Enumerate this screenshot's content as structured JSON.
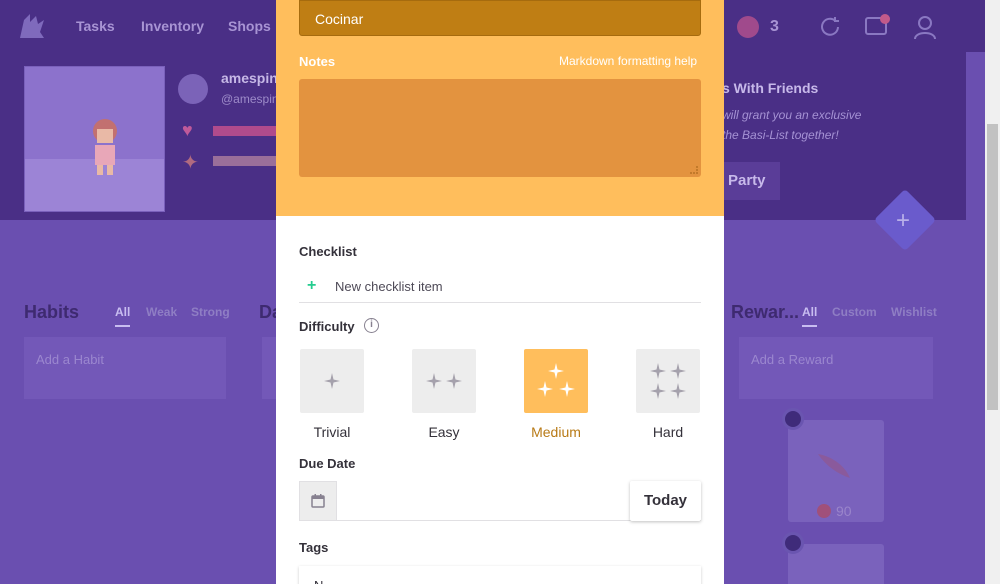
{
  "nav": {
    "items": [
      "Tasks",
      "Inventory",
      "Shops"
    ],
    "gems_count": "3"
  },
  "profile": {
    "name": "amespin",
    "handle": "@amespin"
  },
  "party": {
    "title": "s With Friends",
    "line1": "will grant you an exclusive",
    "line2": "the Basi-List together!",
    "button": "Party"
  },
  "columns": {
    "habits": {
      "title": "Habits",
      "tabs": [
        "All",
        "Weak",
        "Strong"
      ],
      "add": "Add a Habit"
    },
    "dailies": {
      "title": "Da"
    },
    "rewards": {
      "title": "Rewar...",
      "tabs": [
        "All",
        "Custom",
        "Wishlist"
      ],
      "add": "Add a Reward",
      "price": "90"
    }
  },
  "modal": {
    "title_value": "Cocinar",
    "notes_label": "Notes",
    "notes_help": "Markdown formatting help",
    "checklist_label": "Checklist",
    "checklist_placeholder": "New checklist item",
    "difficulty_label": "Difficulty",
    "difficulty_options": [
      {
        "label": "Trivial",
        "selected": false
      },
      {
        "label": "Easy",
        "selected": false
      },
      {
        "label": "Medium",
        "selected": true
      },
      {
        "label": "Hard",
        "selected": false
      }
    ],
    "due_date_label": "Due Date",
    "today_label": "Today",
    "tags_label": "Tags",
    "tags_value": "N"
  },
  "colors": {
    "accent": "#ffbe5c",
    "title_bar": "#bf7e14",
    "notes_bg": "#e3933f",
    "checklist_plus": "#24cc8f",
    "background_purple": "#6a4fb0"
  }
}
